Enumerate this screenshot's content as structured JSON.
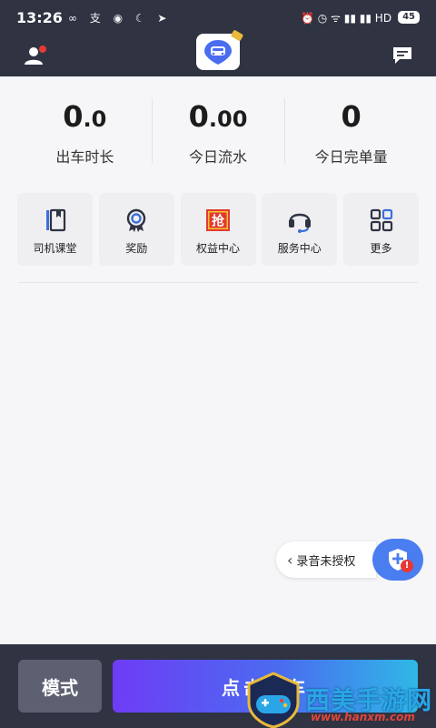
{
  "status_bar": {
    "time": "13:26",
    "left_icons": "∞ 支 ◉ ☾ ➤",
    "right_icons": "⏰ ◷ ᯤ ▮▮ ▮▮ HD",
    "battery": "45"
  },
  "header": {
    "user_icon": "user-icon",
    "logo": "app-logo",
    "message_icon": "message-icon"
  },
  "stats": [
    {
      "value_main": "0",
      "value_small": ".0",
      "label": "出车时长"
    },
    {
      "value_main": "0",
      "value_small": ".00",
      "label": "今日流水"
    },
    {
      "value_main": "0",
      "value_small": "",
      "label": "今日完单量"
    }
  ],
  "menu": [
    {
      "label": "司机课堂",
      "icon": "book-icon"
    },
    {
      "label": "奖励",
      "icon": "medal-icon"
    },
    {
      "label": "权益中心",
      "icon": "grab-badge-icon",
      "badge_text": "抢"
    },
    {
      "label": "服务中心",
      "icon": "headset-icon"
    },
    {
      "label": "更多",
      "icon": "grid-icon"
    }
  ],
  "recording": {
    "label": "录音未授权",
    "alert": "!"
  },
  "bottom": {
    "mode_label": "模式",
    "go_label": "点击出车"
  },
  "watermark": {
    "text": "西美手游网",
    "url": "www.hanxm.com"
  },
  "colors": {
    "dark_bar": "#2f3342",
    "accent_blue": "#4a7df0",
    "gradient_start": "#6e3cf5",
    "gradient_end": "#2fb8e6",
    "alert_red": "#e53935"
  }
}
